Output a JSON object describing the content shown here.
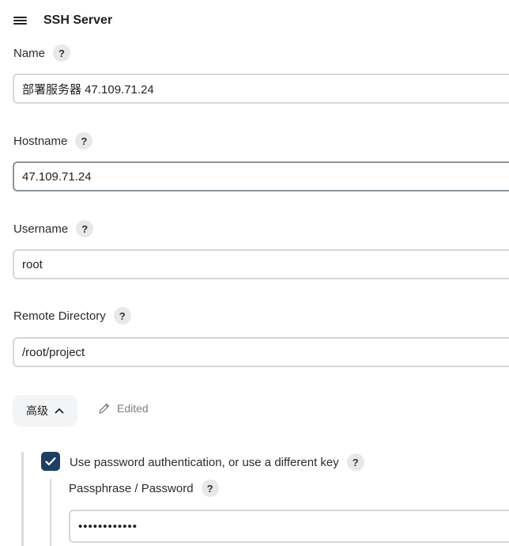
{
  "header": {
    "title": "SSH Server",
    "menu_icon": "hamburger-menu-icon"
  },
  "fields": {
    "name": {
      "label": "Name",
      "value": "部署服务器 47.109.71.24"
    },
    "hostname": {
      "label": "Hostname",
      "value": "47.109.71.24"
    },
    "username": {
      "label": "Username",
      "value": "root"
    },
    "remote_directory": {
      "label": "Remote Directory",
      "value": "/root/project"
    }
  },
  "help_glyph": "?",
  "advanced": {
    "label": "高级",
    "edited_label": "Edited"
  },
  "password_auth": {
    "checked": true,
    "label": "Use password authentication, or use a different key",
    "passphrase_label": "Passphrase / Password",
    "passphrase_value": "••••••••••••"
  },
  "colors": {
    "checkbox": "#1d3f63",
    "input_border": "#d3d7dc",
    "focused_border": "#8c939a"
  }
}
